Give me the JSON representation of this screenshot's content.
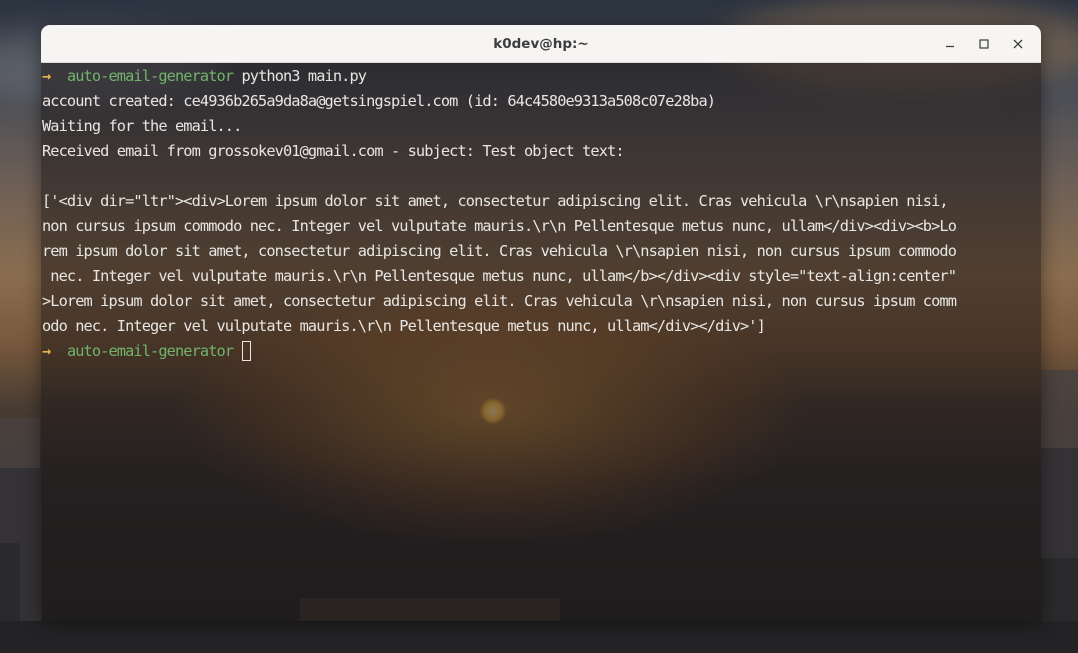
{
  "window": {
    "title": "k0dev@hp:~",
    "controls": {
      "minimize_icon": "minimize-icon",
      "maximize_icon": "maximize-icon",
      "close_icon": "close-icon"
    }
  },
  "terminal": {
    "prompt_symbol": "→",
    "prompt_directory": "auto-email-generator",
    "command": "python3 main.py",
    "output": [
      "account created: ce4936b265a9da8a@getsingspiel.com (id: 64c4580e9313a508c07e28ba)",
      "Waiting for the email...",
      "Received email from grossokev01@gmail.com - subject: Test object text:",
      "",
      "['<div dir=\"ltr\"><div>Lorem ipsum dolor sit amet, consectetur adipiscing elit. Cras vehicula \\r\\nsapien nisi,",
      "non cursus ipsum commodo nec. Integer vel vulputate mauris.\\r\\n Pellentesque metus nunc, ullam</div><div><b>Lo",
      "rem ipsum dolor sit amet, consectetur adipiscing elit. Cras vehicula \\r\\nsapien nisi, non cursus ipsum commodo",
      " nec. Integer vel vulputate mauris.\\r\\n Pellentesque metus nunc, ullam</b></div><div style=\"text-align:center\"",
      ">Lorem ipsum dolor sit amet, consectetur adipiscing elit. Cras vehicula \\r\\nsapien nisi, non cursus ipsum comm",
      "odo nec. Integer vel vulputate mauris.\\r\\n Pellentesque metus nunc, ullam</div></div>']"
    ],
    "second_prompt_directory": "auto-email-generator"
  },
  "colors": {
    "prompt_arrow": "#e4b54a",
    "prompt_directory": "#72b36b",
    "text": "#e8e6e3",
    "titlebar": "#f6f5f4"
  }
}
